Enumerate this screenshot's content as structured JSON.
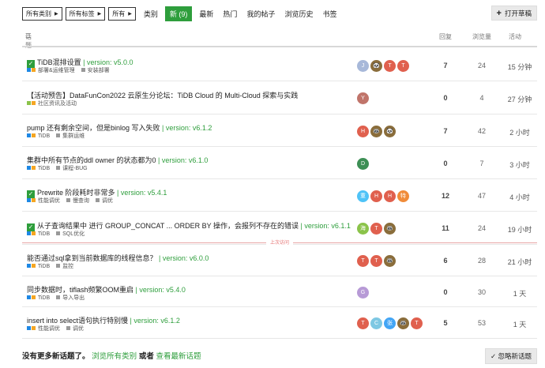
{
  "filters": {
    "category": "所有类别",
    "tag": "所有标签",
    "scope": "所有"
  },
  "nav": {
    "categories": "类别",
    "new": "新 (9)",
    "latest": "最新",
    "hot": "热门",
    "my_posts": "我的帖子",
    "history": "浏览历史",
    "bookmarks": "书签",
    "open_drafts": "打开草稿"
  },
  "columns": {
    "topic": "话题",
    "replies": "回复",
    "views": "浏览量",
    "activity": "活动"
  },
  "topics": [
    {
      "solved": true,
      "title": "TiDB混排设置",
      "version": "version: v5.0.0",
      "category": "部署&运维管理",
      "tags": [
        "安装部署"
      ],
      "avatars": [
        "J",
        "🐼",
        "T",
        "T"
      ],
      "replies": "7",
      "views": "24",
      "activity": "15 分钟"
    },
    {
      "solved": false,
      "title": "【活动预告】DataFunCon2022 云原生分论坛：TiDB Cloud 的 Multi-Cloud 探索与实践",
      "version": "",
      "category": "社区资讯及活动",
      "tags": [],
      "avatars": [
        "Y"
      ],
      "replies": "0",
      "views": "4",
      "activity": "27 分钟"
    },
    {
      "solved": false,
      "title": "pump 还有剩余空间，但是binlog 写入失败",
      "version": "version: v6.1.2",
      "category": "TiDB",
      "tags": [
        "集群运维"
      ],
      "avatars": [
        "H",
        "🦝",
        "🐼"
      ],
      "replies": "7",
      "views": "42",
      "activity": "2 小时"
    },
    {
      "solved": false,
      "title": "集群中所有节点的ddl owner 的状态都为0",
      "version": "version: v6.1.0",
      "category": "TiDB",
      "tags": [
        "课程-BUG"
      ],
      "avatars": [
        "D"
      ],
      "replies": "0",
      "views": "7",
      "activity": "3 小时"
    },
    {
      "solved": true,
      "title": "Prewrite 阶段耗时非常多",
      "version": "version: v5.4.1",
      "category": "性能调优",
      "tags": [
        "慢查询",
        "调优"
      ],
      "avatars": [
        "重",
        "H",
        "H",
        "特"
      ],
      "replies": "12",
      "views": "47",
      "activity": "4 小时"
    },
    {
      "solved": true,
      "title": "从子查询结果中 进行 GROUP_CONCAT ... ORDER BY 操作，会报列不存在的错误",
      "version": "version: v6.1.1",
      "category": "TiDB",
      "tags": [
        "SQL优化"
      ],
      "avatars": [
        "海",
        "T",
        "🦝"
      ],
      "replies": "11",
      "views": "24",
      "activity": "19 小时"
    },
    {
      "solved": false,
      "title": "能否通过sql拿到当前数据库的线程信息？",
      "version": "version: v6.0.0",
      "category": "TiDB",
      "tags": [
        "监控"
      ],
      "avatars": [
        "T",
        "T",
        "🦝"
      ],
      "replies": "6",
      "views": "28",
      "activity": "21 小时"
    },
    {
      "solved": false,
      "title": "同步数据时，tiflash频繁OOM重启",
      "version": "version: v5.4.0",
      "category": "TiDB",
      "tags": [
        "导入导出"
      ],
      "avatars": [
        "G"
      ],
      "replies": "0",
      "views": "30",
      "activity": "1 天"
    },
    {
      "solved": false,
      "title": "insert into select语句执行特别慢",
      "version": "version: v6.1.2",
      "category": "性能调优",
      "tags": [
        "调优"
      ],
      "avatars": [
        "T",
        "C",
        "张",
        "🦝",
        "T"
      ],
      "replies": "5",
      "views": "53",
      "activity": "1 天"
    }
  ],
  "last_visit": "上次访问",
  "footer": {
    "prefix": "没有更多新话题了。",
    "browse_all": "浏览所有类别",
    "or": "或者",
    "view_latest": "查看最新话题",
    "dismiss": "忽略新话题"
  },
  "colors": {
    "accent": "#2e9e3c",
    "last_visit_line": "#e8a6a6"
  }
}
